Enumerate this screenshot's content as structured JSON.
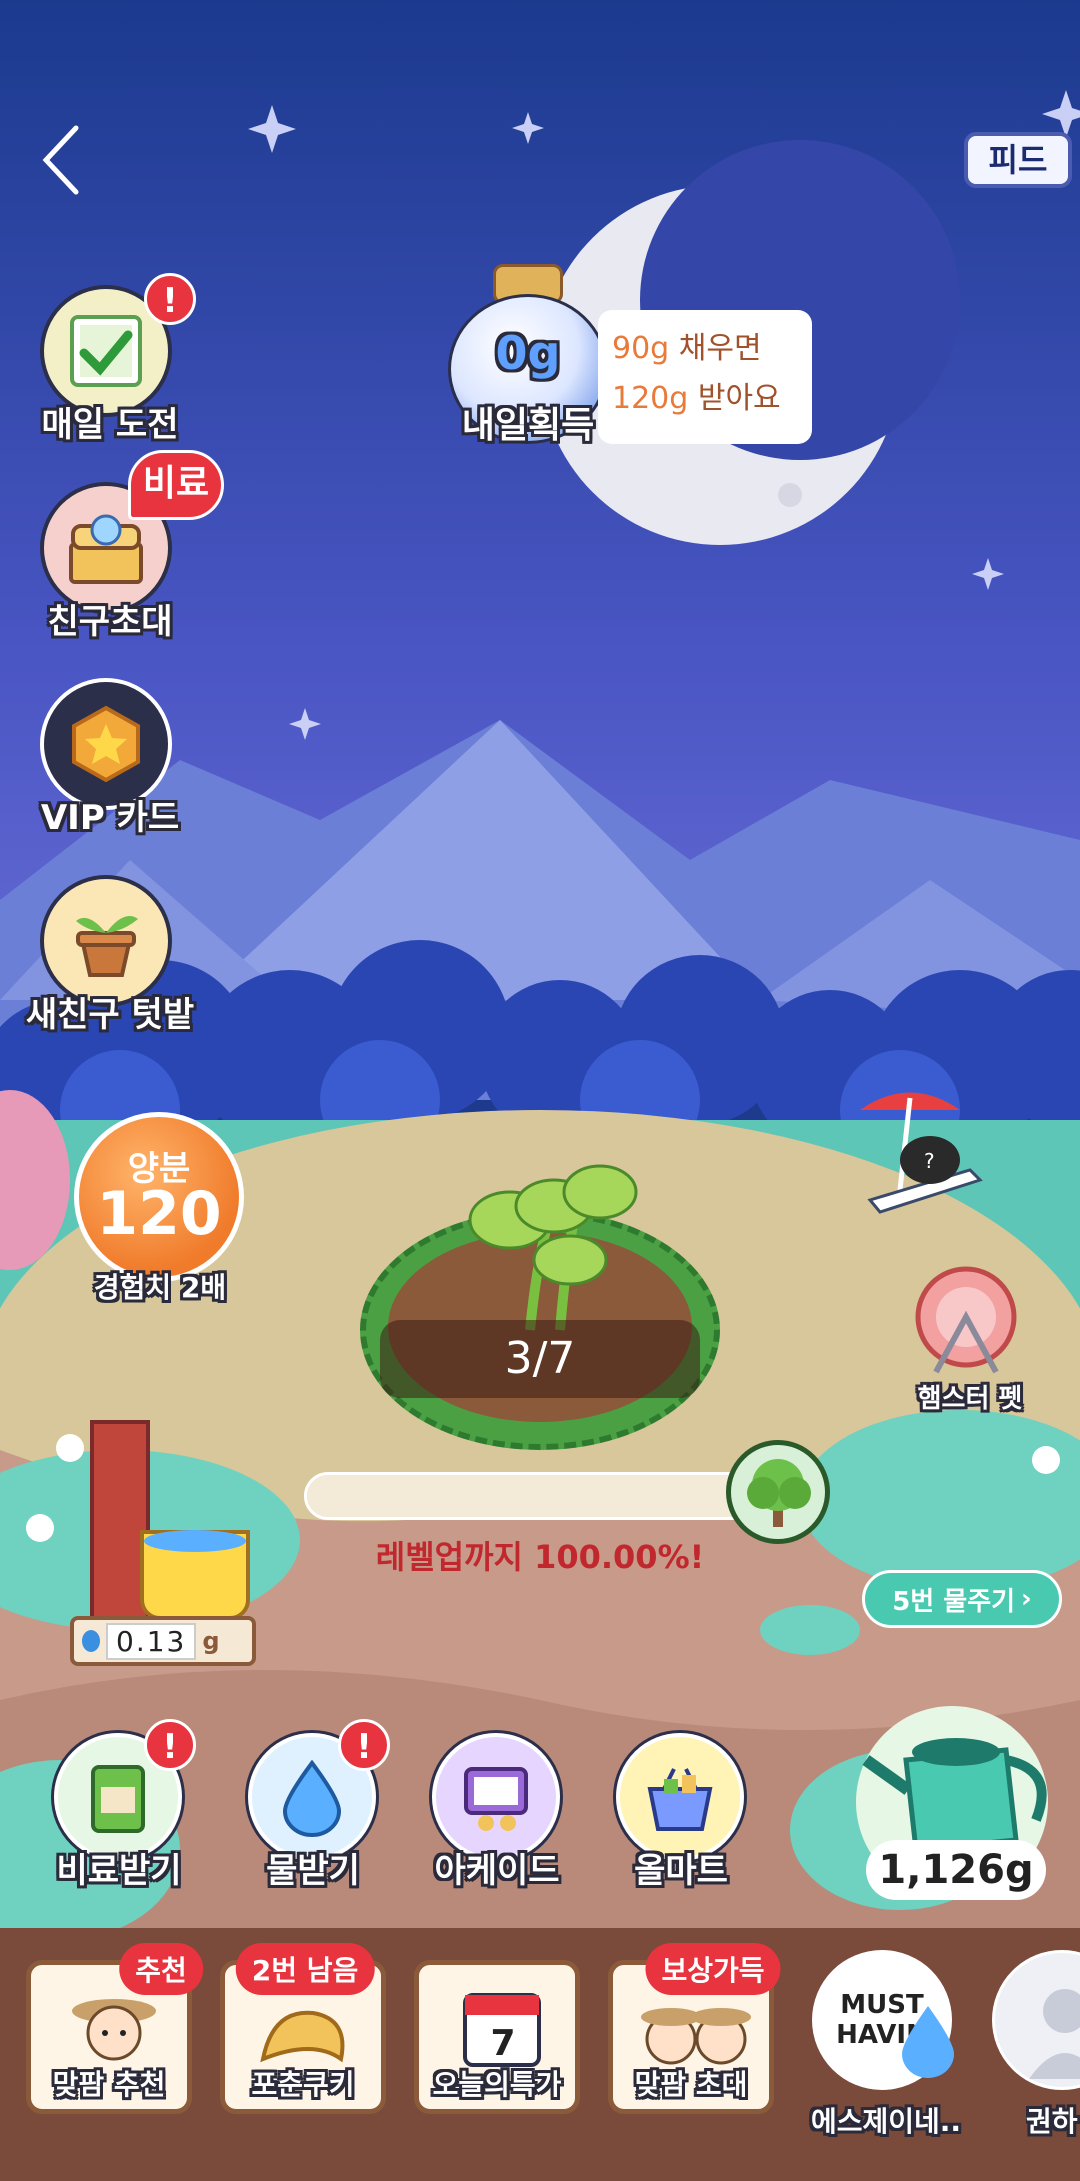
{
  "nav": {
    "feed_label": "피드"
  },
  "reward": {
    "jar_amount": "0g",
    "jar_caption": "내일획득",
    "line1_value": "90g",
    "line1_text": " 채우면",
    "line2_value": "120g",
    "line2_text": " 받아요"
  },
  "side_menu": {
    "daily": {
      "label": "매일 도전",
      "badge": "!"
    },
    "invite": {
      "label": "친구초대",
      "badge": "비료"
    },
    "vip": {
      "label": "VIP 카드"
    },
    "newfriend": {
      "label": "새친구 텃밭"
    }
  },
  "nutrient": {
    "title": "양분",
    "value": "120",
    "caption": "경험치 2배"
  },
  "plant": {
    "progress": "3/7",
    "levelup_text": "레벨업까지 100.00%!",
    "levelup_fraction": 1.0
  },
  "hamster": {
    "label": "햄스터 펫"
  },
  "water_tank": {
    "value": "0.13",
    "unit": "g"
  },
  "water_five": {
    "label": "5번 물주기"
  },
  "watering_can": {
    "amount": "1,126g"
  },
  "action_buttons": [
    {
      "label": "비료받기",
      "badge": "!"
    },
    {
      "label": "물받기",
      "badge": "!"
    },
    {
      "label": "아케이드"
    },
    {
      "label": "올마트"
    }
  ],
  "bottom_tabs": [
    {
      "label": "맞팜 추천",
      "badge": "추천"
    },
    {
      "label": "포춘쿠키",
      "badge": "2번 남음"
    },
    {
      "label": "오늘의특가",
      "badge": "",
      "calendar_day": "7"
    },
    {
      "label": "맞팜 초대",
      "badge": "보상가득"
    }
  ],
  "friends": [
    {
      "name": "에스제이네..",
      "avatar_text": "MUST HAVIN"
    },
    {
      "name": "권하"
    }
  ],
  "colors": {
    "sky": "#1d3a8c",
    "accent_red": "#e8343f",
    "nutrient_orange": "#f07b2b",
    "mint": "#48c9b0"
  }
}
